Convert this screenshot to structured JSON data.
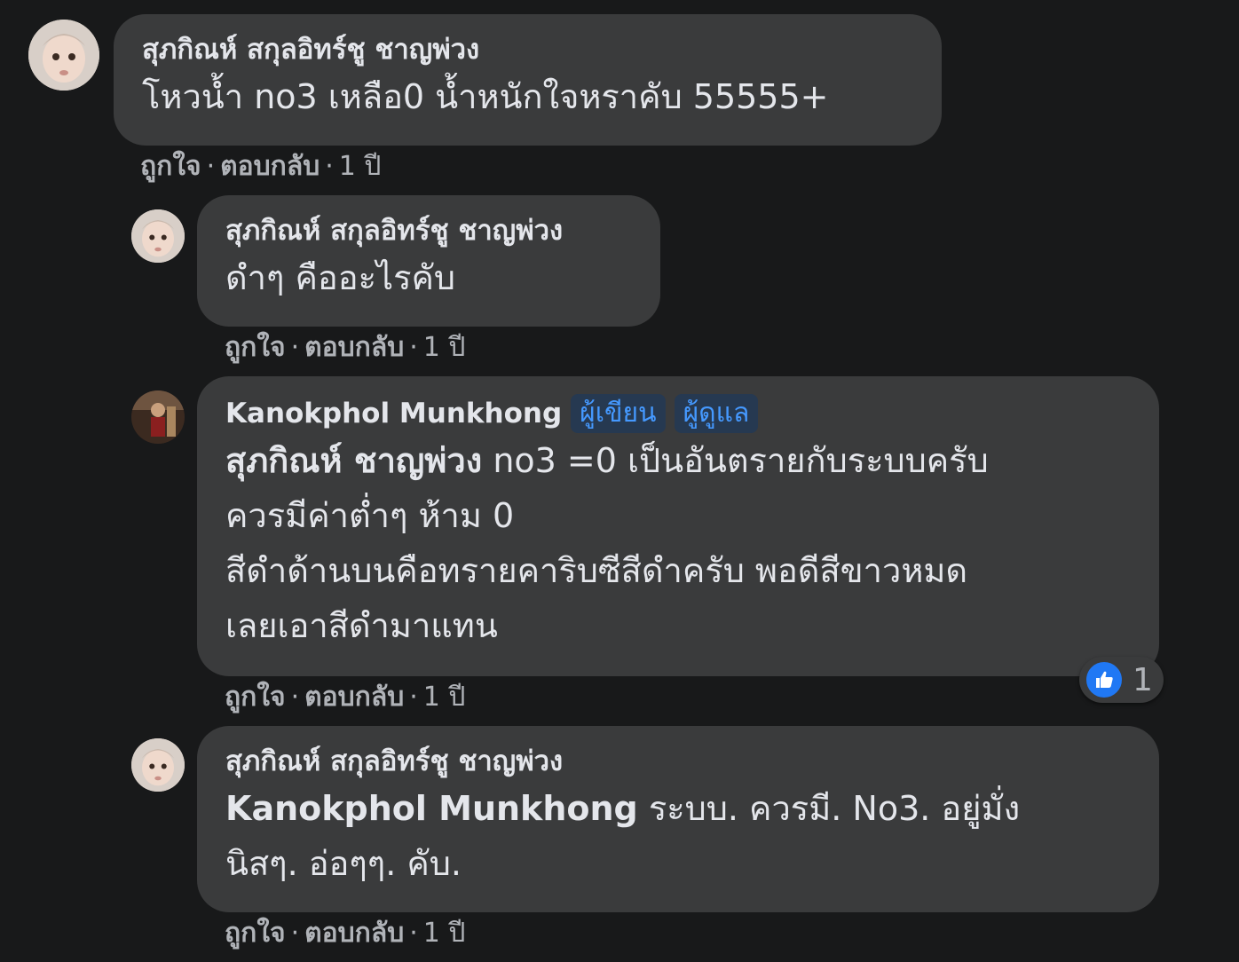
{
  "comments": [
    {
      "author": "สุภกิณห์ สกุลอิทร์ชู ชาญพ่วง",
      "text": "โหวน้ำ no3 เหลือ0 น้ำหนักใจหราคับ 55555+",
      "like_label": "ถูกใจ",
      "reply_label": "ตอบกลับ",
      "time": "1 ปี"
    },
    {
      "author": "สุภกิณห์ สกุลอิทร์ชู ชาญพ่วง",
      "text": "ดำๆ คืออะไรคับ",
      "like_label": "ถูกใจ",
      "reply_label": "ตอบกลับ",
      "time": "1 ปี"
    },
    {
      "author": "Kanokphol Munkhong",
      "badges": [
        "ผู้เขียน",
        "ผู้ดูแล"
      ],
      "mention": "สุภกิณห์ ชาญพ่วง",
      "text_line1": " no3 =0 เป็นอันตรายกับระบบครับ",
      "text_line2": "ควรมีค่าต่ำๆ ห้าม 0",
      "text_line3": "สีดำด้านบนคือทรายคาริบซีสีดำครับ พอดีสีขาวหมด",
      "text_line4": "เลยเอาสีดำมาแทน",
      "reaction_count": "1",
      "like_label": "ถูกใจ",
      "reply_label": "ตอบกลับ",
      "time": "1 ปี"
    },
    {
      "author": "สุภกิณห์ สกุลอิทร์ชู ชาญพ่วง",
      "mention": "Kanokphol Munkhong",
      "text_line1": " ระบบ. ควรมี. No3. อยู่มั่ง",
      "text_line2": "นิสๆ. อ่อๆๆ. คับ.",
      "like_label": "ถูกใจ",
      "reply_label": "ตอบกลับ",
      "time": "1 ปี"
    }
  ],
  "colors": {
    "background": "#18191a",
    "bubble": "#3a3b3c",
    "text": "#e4e6eb",
    "secondary_text": "#b0b3b8",
    "badge_bg": "#263951",
    "badge_text": "#4599ff",
    "like_blue": "#2078f4"
  },
  "icons": {
    "reaction": "thumbs-up-icon"
  }
}
